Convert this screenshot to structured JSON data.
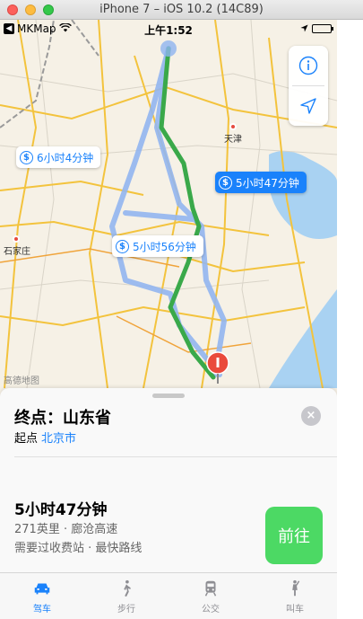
{
  "window": {
    "title": "iPhone 7 – iOS 10.2 (14C89)"
  },
  "status_bar": {
    "back_app": "MKMap",
    "time": "上午1:52"
  },
  "map": {
    "cities": [
      {
        "name": "天津"
      },
      {
        "name": "石家庄"
      }
    ],
    "watermark": "高德地图",
    "route_callouts": [
      {
        "label": "6小时4分钟",
        "primary": false
      },
      {
        "label": "5小时47分钟",
        "primary": true
      },
      {
        "label": "5小时56分钟",
        "primary": false
      }
    ],
    "icons": {
      "info": "info-icon",
      "location": "location-arrow-icon",
      "toll": "dollar-icon",
      "pin": "destination-pin-icon"
    }
  },
  "card": {
    "destination": "终点：山东省",
    "origin_label": "起点",
    "origin_value": "北京市",
    "route": {
      "duration": "5小时47分钟",
      "info": "271英里 · 廊沧高速",
      "note": "需要过收费站 · 最快路线"
    },
    "go_button": "前往",
    "close_icon": "×"
  },
  "tabs": [
    {
      "label": "驾车",
      "icon": "car-icon",
      "active": true
    },
    {
      "label": "步行",
      "icon": "walk-icon",
      "active": false
    },
    {
      "label": "公交",
      "icon": "train-icon",
      "active": false
    },
    {
      "label": "叫车",
      "icon": "ride-icon",
      "active": false
    }
  ],
  "colors": {
    "accent": "#1a82fb",
    "route_main": "#3aa94a",
    "route_alt": "#8fb4f0",
    "go": "#4cd964"
  }
}
